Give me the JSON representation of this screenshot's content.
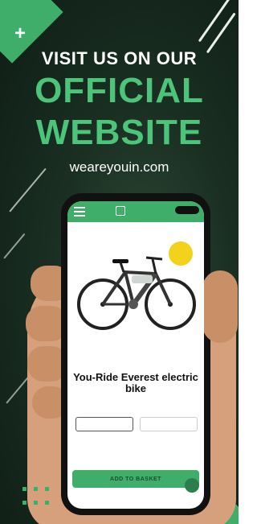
{
  "banner": {
    "headline_top": "VISIT US ON OUR",
    "headline_mid": "OFFICIAL",
    "headline_bottom": "WEBSITE",
    "website_url": "weareyouin.com",
    "accent_color": "#3fae6a"
  },
  "phone_app": {
    "product_title": "You-Ride Everest electric bike",
    "add_to_basket_label": "ADD TO BASKET",
    "icons": [
      "menu-icon",
      "logo-icon",
      "bike-image",
      "sale-badge",
      "chat-icon"
    ]
  }
}
